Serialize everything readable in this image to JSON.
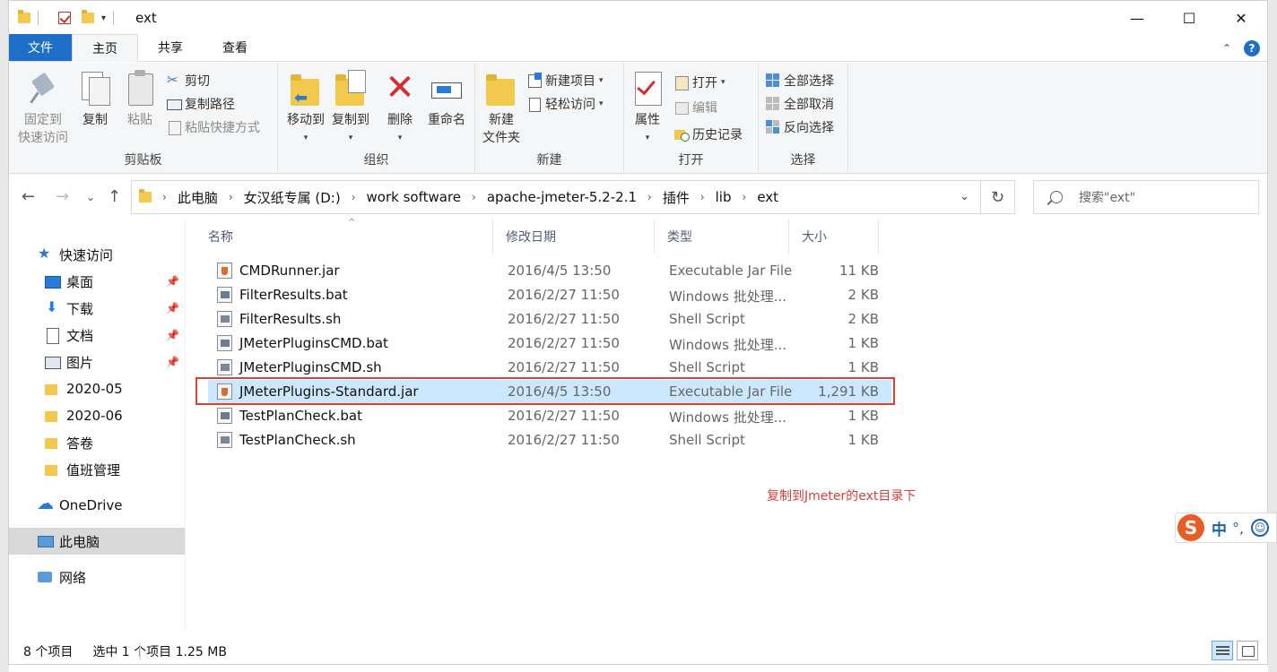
{
  "window": {
    "title": "ext"
  },
  "window_controls": {
    "minimize": "—",
    "maximize": "☐",
    "close": "✕"
  },
  "ribbon_tabs": [
    "文件",
    "主页",
    "共享",
    "查看"
  ],
  "ribbon": {
    "clipboard": {
      "label": "剪贴板",
      "pin_line1": "固定到",
      "pin_line2": "快速访问",
      "copy": "复制",
      "paste": "粘贴",
      "cut": "剪切",
      "copy_path": "复制路径",
      "paste_shortcut": "粘贴快捷方式"
    },
    "organize": {
      "label": "组织",
      "move_to": "移动到",
      "copy_to": "复制到",
      "delete": "删除",
      "rename": "重命名"
    },
    "new": {
      "label": "新建",
      "new_folder_line1": "新建",
      "new_folder_line2": "文件夹",
      "new_item": "新建项目",
      "easy_access": "轻松访问"
    },
    "open": {
      "label": "打开",
      "properties": "属性",
      "open": "打开",
      "edit": "编辑",
      "history": "历史记录"
    },
    "select": {
      "label": "选择",
      "select_all": "全部选择",
      "select_none": "全部取消",
      "invert": "反向选择"
    }
  },
  "address": {
    "crumbs": [
      "此电脑",
      "女汉纸专属 (D:)",
      "work software",
      "apache-jmeter-5.2-2.1",
      "插件",
      "lib",
      "ext"
    ]
  },
  "search": {
    "placeholder": "搜索\"ext\""
  },
  "sidebar": {
    "items": [
      {
        "label": "快速访问",
        "icon": "star-icon"
      },
      {
        "label": "桌面",
        "icon": "desktop-icon",
        "pinned": true
      },
      {
        "label": "下载",
        "icon": "download-icon",
        "pinned": true
      },
      {
        "label": "文档",
        "icon": "document-icon",
        "pinned": true
      },
      {
        "label": "图片",
        "icon": "pictures-icon",
        "pinned": true
      },
      {
        "label": "2020-05",
        "icon": "folder-icon"
      },
      {
        "label": "2020-06",
        "icon": "folder-icon"
      },
      {
        "label": "答卷",
        "icon": "folder-icon"
      },
      {
        "label": "值班管理",
        "icon": "folder-icon"
      },
      {
        "label": "OneDrive",
        "icon": "cloud-icon"
      },
      {
        "label": "此电脑",
        "icon": "computer-icon",
        "selected": true
      },
      {
        "label": "网络",
        "icon": "network-icon"
      }
    ]
  },
  "columns": [
    "名称",
    "修改日期",
    "类型",
    "大小"
  ],
  "files": [
    {
      "name": "CMDRunner.jar",
      "date": "2016/4/5 13:50",
      "type": "Executable Jar File",
      "size": "11 KB",
      "kind": "jar"
    },
    {
      "name": "FilterResults.bat",
      "date": "2016/2/27 11:50",
      "type": "Windows 批处理...",
      "size": "2 KB",
      "kind": "bat"
    },
    {
      "name": "FilterResults.sh",
      "date": "2016/2/27 11:50",
      "type": "Shell Script",
      "size": "2 KB",
      "kind": "sh"
    },
    {
      "name": "JMeterPluginsCMD.bat",
      "date": "2016/2/27 11:50",
      "type": "Windows 批处理...",
      "size": "1 KB",
      "kind": "bat"
    },
    {
      "name": "JMeterPluginsCMD.sh",
      "date": "2016/2/27 11:50",
      "type": "Shell Script",
      "size": "1 KB",
      "kind": "sh"
    },
    {
      "name": "JMeterPlugins-Standard.jar",
      "date": "2016/4/5 13:50",
      "type": "Executable Jar File",
      "size": "1,291 KB",
      "kind": "jar",
      "selected": true
    },
    {
      "name": "TestPlanCheck.bat",
      "date": "2016/2/27 11:50",
      "type": "Windows 批处理...",
      "size": "1 KB",
      "kind": "bat"
    },
    {
      "name": "TestPlanCheck.sh",
      "date": "2016/2/27 11:50",
      "type": "Shell Script",
      "size": "1 KB",
      "kind": "sh"
    }
  ],
  "annotation": "复制到Jmeter的ext目录下",
  "ime": {
    "logo": "S",
    "mode": "中",
    "punct": "°,",
    "face": "☺"
  },
  "status": {
    "count": "8 个项目",
    "selection": "选中 1 个项目  1.25 MB"
  },
  "colors": {
    "accent": "#1e6fc8",
    "selection": "#cce8ff",
    "highlight": "#d9403a"
  }
}
